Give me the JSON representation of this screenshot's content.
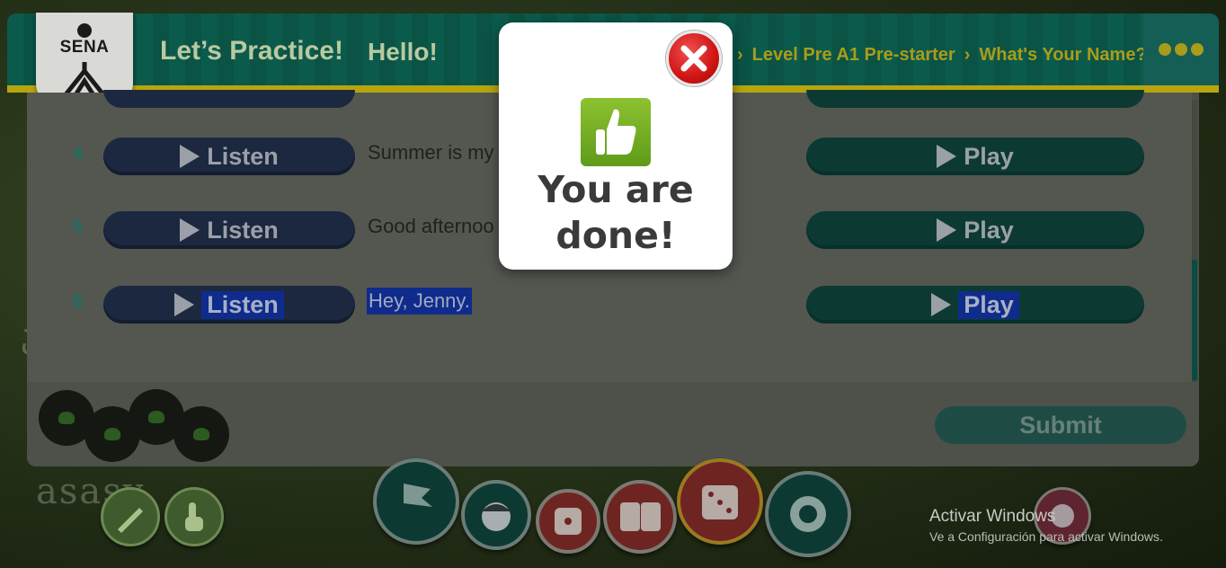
{
  "header": {
    "title": "Let’s Practice!",
    "subtitle": "Hello!",
    "logo_text": "SENA",
    "breadcrumb": [
      "Level Pre A1 Pre-starter",
      "What's Your Name?"
    ]
  },
  "rows": [
    {
      "number": "4",
      "listen_label": "Listen",
      "sentence": "Summer is my",
      "play_label": "Play"
    },
    {
      "number": "5",
      "listen_label": "Listen",
      "sentence": "Good afternoo",
      "play_label": "Play"
    },
    {
      "number": "6",
      "listen_label": "Listen",
      "sentence": "Hey, Jenny.",
      "play_label": "Play"
    }
  ],
  "footer": {
    "submit_label": "Submit"
  },
  "modal": {
    "message": "You are done!"
  },
  "watermark": {
    "title": "Activar Windows",
    "subtitle": "Ve a Configuración para activar Windows."
  },
  "colors": {
    "header_bg": "#0b5b4c",
    "header_border": "#b7a50e",
    "listen_button": "#1c2840",
    "play_button": "#0c3a32",
    "highlight": "#0f2b8c",
    "close_red": "#d01414",
    "thumb_green": "#7ab827"
  }
}
